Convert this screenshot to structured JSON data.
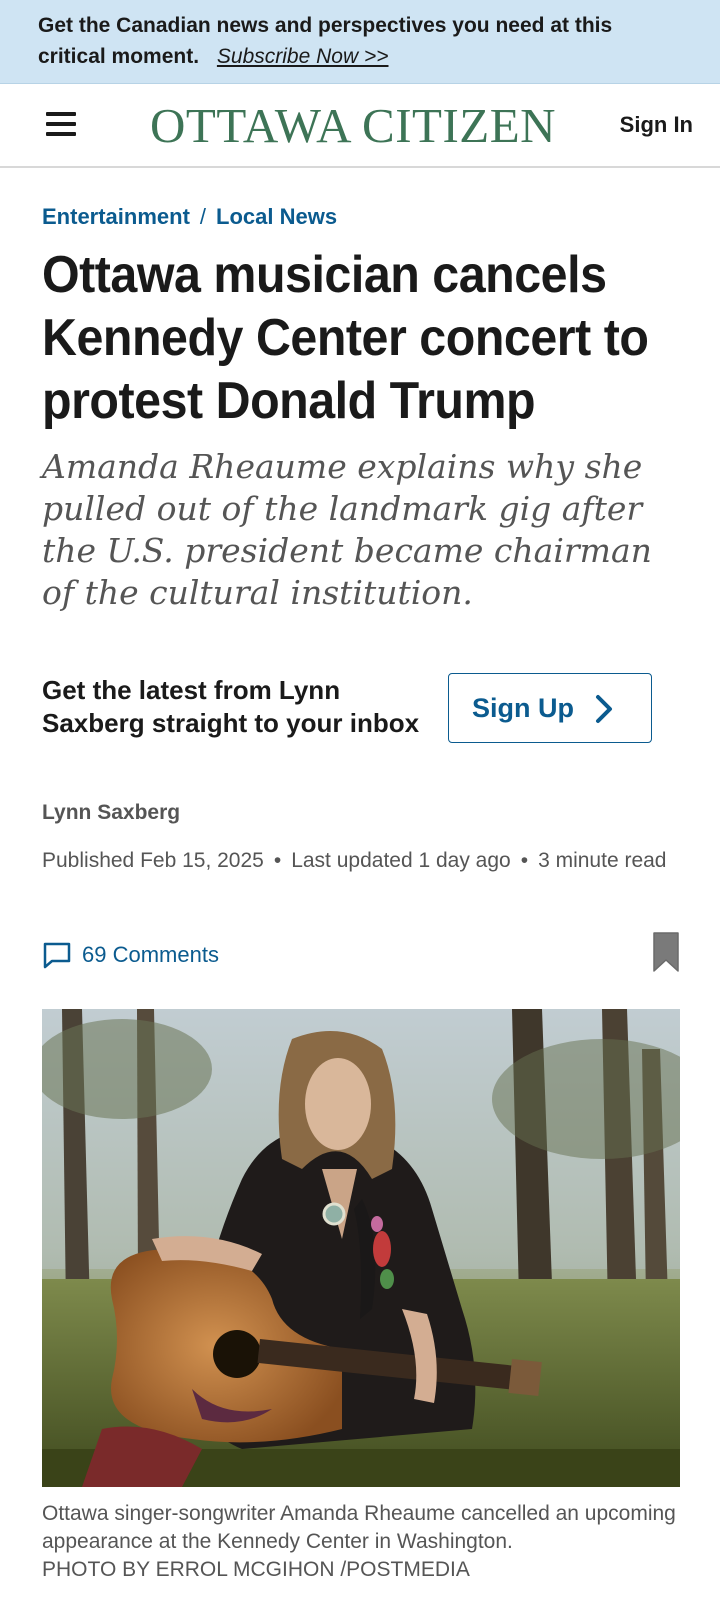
{
  "promo": {
    "text": "Get the Canadian news and perspectives you need at this critical moment.",
    "link_label": "Subscribe Now >>"
  },
  "header": {
    "menu_icon": "hamburger-menu-icon",
    "logo_text": "Ottawa Citizen",
    "sign_in_label": "Sign In",
    "brand_color": "#3d7456"
  },
  "breadcrumb": {
    "section": "Entertainment",
    "separator": "/",
    "subsection": "Local News"
  },
  "article": {
    "headline": "Ottawa musician cancels Kennedy Center concert to protest Donald Trump",
    "deck": "Amanda Rheaume explains why she pulled out of the landmark gig after the U.S. president became chairman of the cultural institution.",
    "newsletter_text": "Get the latest from Lynn Saxberg straight to your inbox",
    "signup_label": "Sign Up",
    "author": "Lynn Saxberg",
    "published": "Published Feb 15, 2025",
    "updated": "Last updated 1 day ago",
    "read_time": "3 minute read",
    "meta_separator": "•",
    "comments_label": "69 Comments",
    "image_caption": "Ottawa singer-songwriter Amanda Rheaume cancelled an upcoming appearance at the Kennedy Center in Washington.",
    "image_credit": "PHOTO BY ERROL MCGIHON /POSTMEDIA"
  },
  "colors": {
    "accent": "#0b5b8f",
    "promo_bg": "#cfe4f3",
    "muted_text": "#555555"
  }
}
